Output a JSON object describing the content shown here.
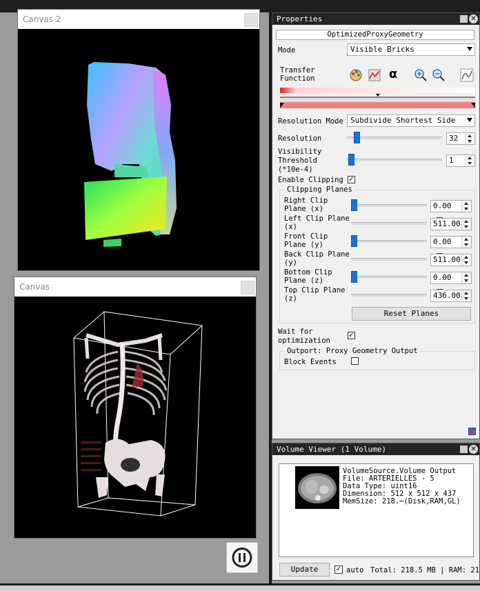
{
  "canvas2": {
    "title": "Canvas 2"
  },
  "canvas": {
    "title": "Canvas"
  },
  "pause_button": {
    "icon": "pause-icon"
  },
  "properties": {
    "title": "Properties",
    "processor_name": "OptimizedProxyGeometry",
    "mode_label": "Mode",
    "mode_value": "Visible Bricks",
    "transfer_function_label": "Transfer\nFunction",
    "tf_buttons": [
      "palette-icon",
      "histogram-icon",
      "alpha-icon",
      "zoom-in-icon",
      "zoom-out-icon",
      "curve-icon"
    ],
    "resolution_mode_label": "Resolution Mode",
    "resolution_mode_value": "Subdivide Shortest Side",
    "resolution_label": "Resolution",
    "resolution_value": "32",
    "visibility_threshold_label": "Visibility\nThreshold\n(*10e-4)",
    "visibility_threshold_value": "1",
    "enable_clipping_label": "Enable Clipping",
    "enable_clipping_checked": true,
    "clipping_planes_title": "Clipping Planes",
    "clip_planes": [
      {
        "label": "Right Clip\nPlane (x)",
        "value": "0.00"
      },
      {
        "label": "Left Clip Plane\n(x)",
        "value": "511.00"
      },
      {
        "label": "Front Clip\nPlane (y)",
        "value": "0.00"
      },
      {
        "label": "Back Clip Plane\n(y)",
        "value": "511.00"
      },
      {
        "label": "Bottom Clip\nPlane (z)",
        "value": "0.00"
      },
      {
        "label": "Top Clip Plane\n(z)",
        "value": "436.00"
      }
    ],
    "reset_planes_label": "Reset Planes",
    "wait_label": "Wait for\noptimization",
    "wait_checked": true,
    "outport_title": "Outport: Proxy Geometry Output",
    "block_events_label": "Block Events",
    "block_events_checked": false
  },
  "volume_viewer": {
    "title": "Volume Viewer (1 Volume)",
    "source": "VolumeSource.Volume Output",
    "file": "File: ARTERIELLES - 5",
    "data_type": "Data Type: uint16",
    "dimension": "Dimension: 512 x 512 x 437",
    "mem_size": "MemSize: 218.⋯(Disk,RAM,GL)",
    "update_label": "Update",
    "auto_checked": true,
    "auto_label": "auto",
    "total_label": "Total: 218.5 MB | RAM: 21"
  },
  "colors": {
    "accent": "#1773d6",
    "title_bar": "#252525",
    "tf_red": "#f08080"
  }
}
